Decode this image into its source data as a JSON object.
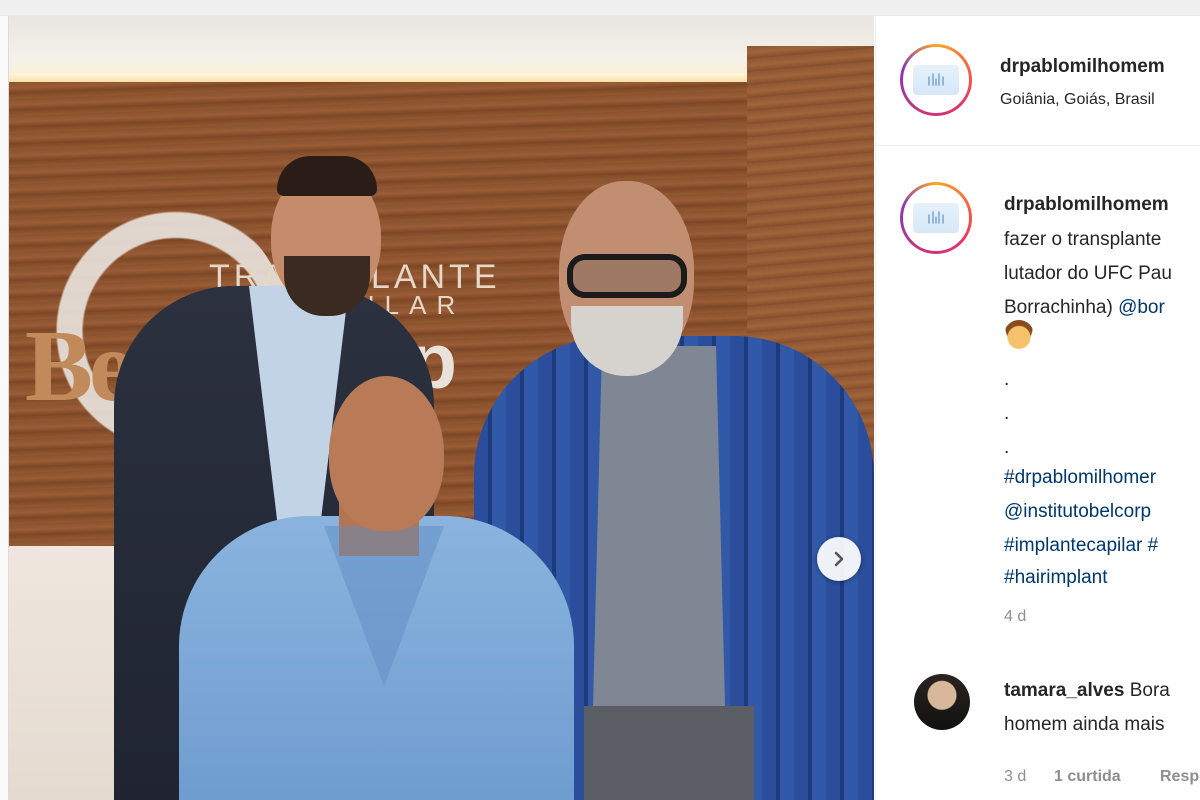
{
  "post": {
    "photo_text": {
      "brand_line1": "TRANSPLANTE",
      "brand_line2": "CAPILAR",
      "brand_mark": "Be",
      "brand_mark2": "rp"
    },
    "next_icon": "chevron-right-icon"
  },
  "side": {
    "header": {
      "username": "drpablomilhomem",
      "location": "Goiânia, Goiás, Brasil"
    },
    "caption": {
      "username": "drpablomilhomem",
      "line1": "fazer o transplante",
      "line2": "lutador do UFC Pau",
      "line3_text": "Borrachinha) ",
      "line3_link": "@bor",
      "emoji": "man-emoji",
      "dots": [
        ".",
        ".",
        "."
      ],
      "tags": [
        "#drpablomilhomer",
        "@institutobelcorp",
        "#implantecapilar #",
        "#hairimplant"
      ],
      "age": "4 d"
    },
    "comment": {
      "username": "tamara_alves",
      "text_line1": "Bora",
      "text_line2": "homem ainda mais",
      "age": "3 d",
      "likes": "1 curtida",
      "reply": "Resp"
    }
  },
  "colors": {
    "link": "#00376b",
    "muted": "#8e8e8e",
    "text": "#262626"
  }
}
